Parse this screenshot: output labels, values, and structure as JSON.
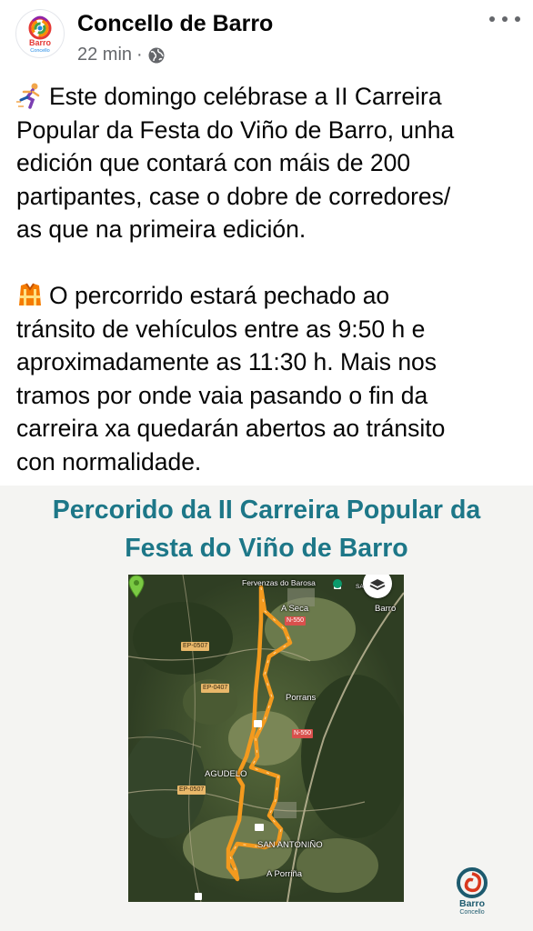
{
  "post": {
    "author": "Concello de Barro",
    "time": "22 min",
    "separator": "·",
    "privacy_icon": "globe-icon",
    "more_icon": "more-options-icon",
    "avatar": {
      "logo_text": "Barro",
      "logo_sub": "Concello"
    },
    "paragraph1": {
      "emoji": "runner-emoji",
      "lines": [
        "Este domingo celébrase a II Carreira",
        "Popular da Festa do Viño de Barro, unha",
        "edición que contará con máis de 200",
        "partipantes, case o dobre de corredores/",
        "as que na primeira edición."
      ]
    },
    "paragraph2": {
      "emoji": "safety-vest-emoji",
      "lines": [
        "O percorrido estará pechado ao",
        "tránsito de vehículos entre as 9:50 h e",
        "aproximadamente as 11:30 h. Mais nos",
        "tramos por onde vaia pasando o fin da",
        "carreira xa quedarán abertos ao tránsito",
        "con normalidade."
      ]
    }
  },
  "image": {
    "title_lines": [
      "Percorido da II Carreira Popular da",
      "Festa do Viño de Barro"
    ],
    "title_color": "#1d7788",
    "map": {
      "labels": {
        "fervenzas": "Fervenzas do Barosa",
        "a_seca": "A Seca",
        "barro": "Barro",
        "porrans": "Porrans",
        "agudelo": "AGUDELO",
        "san_antonino": "SAN ANTONIÑO",
        "a_porrina": "A Porriña",
        "san_an": "SAN AN"
      },
      "roads": {
        "ep0507_top": "EP-0507",
        "ep0407": "EP-0407",
        "ep0507_bottom": "EP-0507",
        "n550_top": "N-550",
        "n550_mid": "N-550"
      },
      "route_color": "#f39a1e"
    },
    "brand": {
      "text": "Barro",
      "sub": "Concello"
    }
  }
}
